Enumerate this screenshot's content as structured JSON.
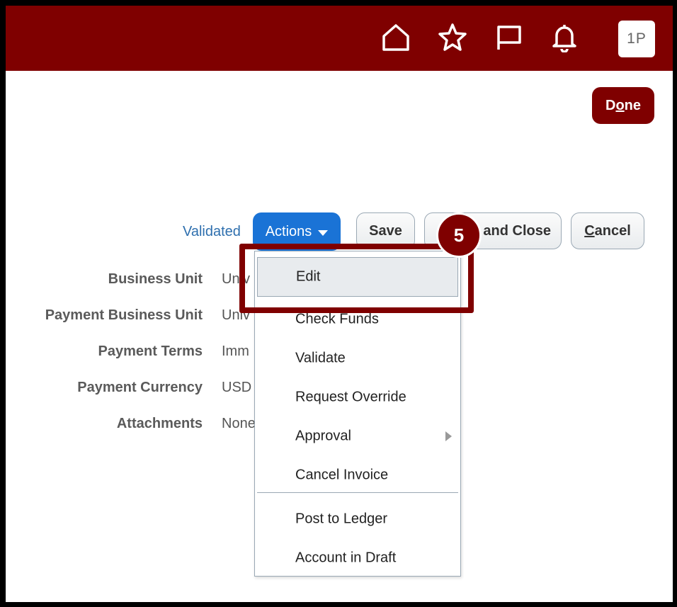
{
  "header": {
    "icons": [
      "home-icon",
      "star-icon",
      "flag-icon",
      "bell-icon"
    ],
    "avatar_initials": "1P",
    "brand_color": "#7f0000"
  },
  "done_button": {
    "label_pre": "D",
    "label_underline": "o",
    "label_post": "ne"
  },
  "toolbar": {
    "status": "Validated",
    "actions_label": "Actions",
    "save_label": "Save",
    "save_close_label": "and Close",
    "cancel_underline": "C",
    "cancel_rest": "ancel"
  },
  "fields": [
    {
      "label": "Business Unit",
      "value": "Univ"
    },
    {
      "label": "Payment Business Unit",
      "value": "Univ"
    },
    {
      "label": "Payment Terms",
      "value": "Imm"
    },
    {
      "label": "Payment Currency",
      "value": "USD"
    },
    {
      "label": "Attachments",
      "value": "None"
    }
  ],
  "actions_menu": {
    "items": [
      {
        "label": "Edit"
      },
      {
        "label": "Check Funds"
      },
      {
        "label": "Validate"
      },
      {
        "label": "Request Override"
      },
      {
        "label": "Approval"
      },
      {
        "label": "Cancel Invoice"
      },
      {
        "label": "Post to Ledger"
      },
      {
        "label": "Account in Draft"
      }
    ]
  },
  "callout": {
    "step": "5"
  }
}
